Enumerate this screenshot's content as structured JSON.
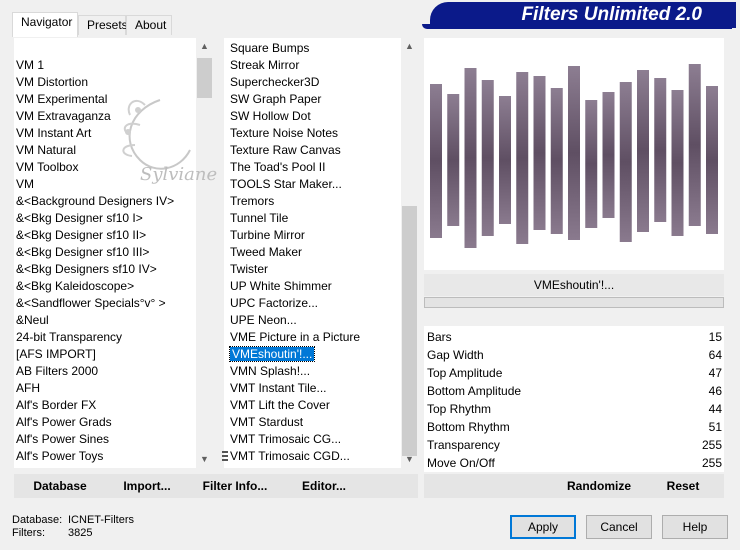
{
  "tabs": [
    {
      "label": "Navigator",
      "active": true
    },
    {
      "label": "Presets",
      "active": false
    },
    {
      "label": "About",
      "active": false
    }
  ],
  "app_title": "Filters Unlimited 2.0",
  "watermark_text": "Sylviane",
  "categories": [
    "VM 1",
    "VM Distortion",
    "VM Experimental",
    "VM Extravaganza",
    "VM Instant Art",
    "VM Natural",
    "VM Toolbox",
    "VM",
    "&<Background Designers IV>",
    "&<Bkg Designer sf10 I>",
    "&<Bkg Designer sf10 II>",
    "&<Bkg Designer sf10 III>",
    "&<Bkg Designers sf10 IV>",
    "&<Bkg Kaleidoscope>",
    "&<Sandflower Specials°v° >",
    "&Neul",
    "24-bit Transparency",
    "[AFS IMPORT]",
    "AB Filters 2000",
    "AFH",
    "Alf's Border FX",
    "Alf's Power Grads",
    "Alf's Power Sines",
    "Alf's Power Toys"
  ],
  "categories_selected_index": 11,
  "filters": [
    "Square Bumps",
    "Streak Mirror",
    "Superchecker3D",
    "SW Graph Paper",
    "SW Hollow Dot",
    "Texture Noise Notes",
    "Texture Raw Canvas",
    "The Toad's Pool II",
    "TOOLS Star Maker...",
    "Tremors",
    "Tunnel Tile",
    "Turbine Mirror",
    "Tweed Maker",
    "Twister",
    "UP White Shimmer",
    "UPC Factorize...",
    "UPE Neon...",
    "VME Picture in a Picture",
    "VMEshoutin'!...",
    "VMN Splash!...",
    "VMT Instant Tile...",
    "VMT Lift the Cover",
    "VMT Stardust",
    "VMT Trimosaic CG...",
    "VMT Trimosaic CGD..."
  ],
  "filters_selected_index": 18,
  "current_filter": "VMEshoutin'!...",
  "parameters": [
    {
      "label": "Bars",
      "value": "15"
    },
    {
      "label": "Gap Width",
      "value": "64"
    },
    {
      "label": "Top Amplitude",
      "value": "47"
    },
    {
      "label": "Bottom Amplitude",
      "value": "46"
    },
    {
      "label": "Top Rhythm",
      "value": "44"
    },
    {
      "label": "Bottom Rhythm",
      "value": "51"
    },
    {
      "label": "Transparency",
      "value": "255"
    },
    {
      "label": "Move On/Off",
      "value": "255"
    }
  ],
  "toolbar": {
    "database": "Database",
    "import": "Import...",
    "filter_info": "Filter Info...",
    "editor": "Editor...",
    "randomize": "Randomize",
    "reset": "Reset"
  },
  "status": {
    "database_label": "Database:",
    "database_value": "ICNET-Filters",
    "filters_label": "Filters:",
    "filters_value": "3825"
  },
  "buttons": {
    "apply": "Apply",
    "cancel": "Cancel",
    "help": "Help"
  },
  "colors": {
    "banner": "#0b1a8a",
    "selection": "#0078d7",
    "bar_fill": "#7a6a7e"
  }
}
